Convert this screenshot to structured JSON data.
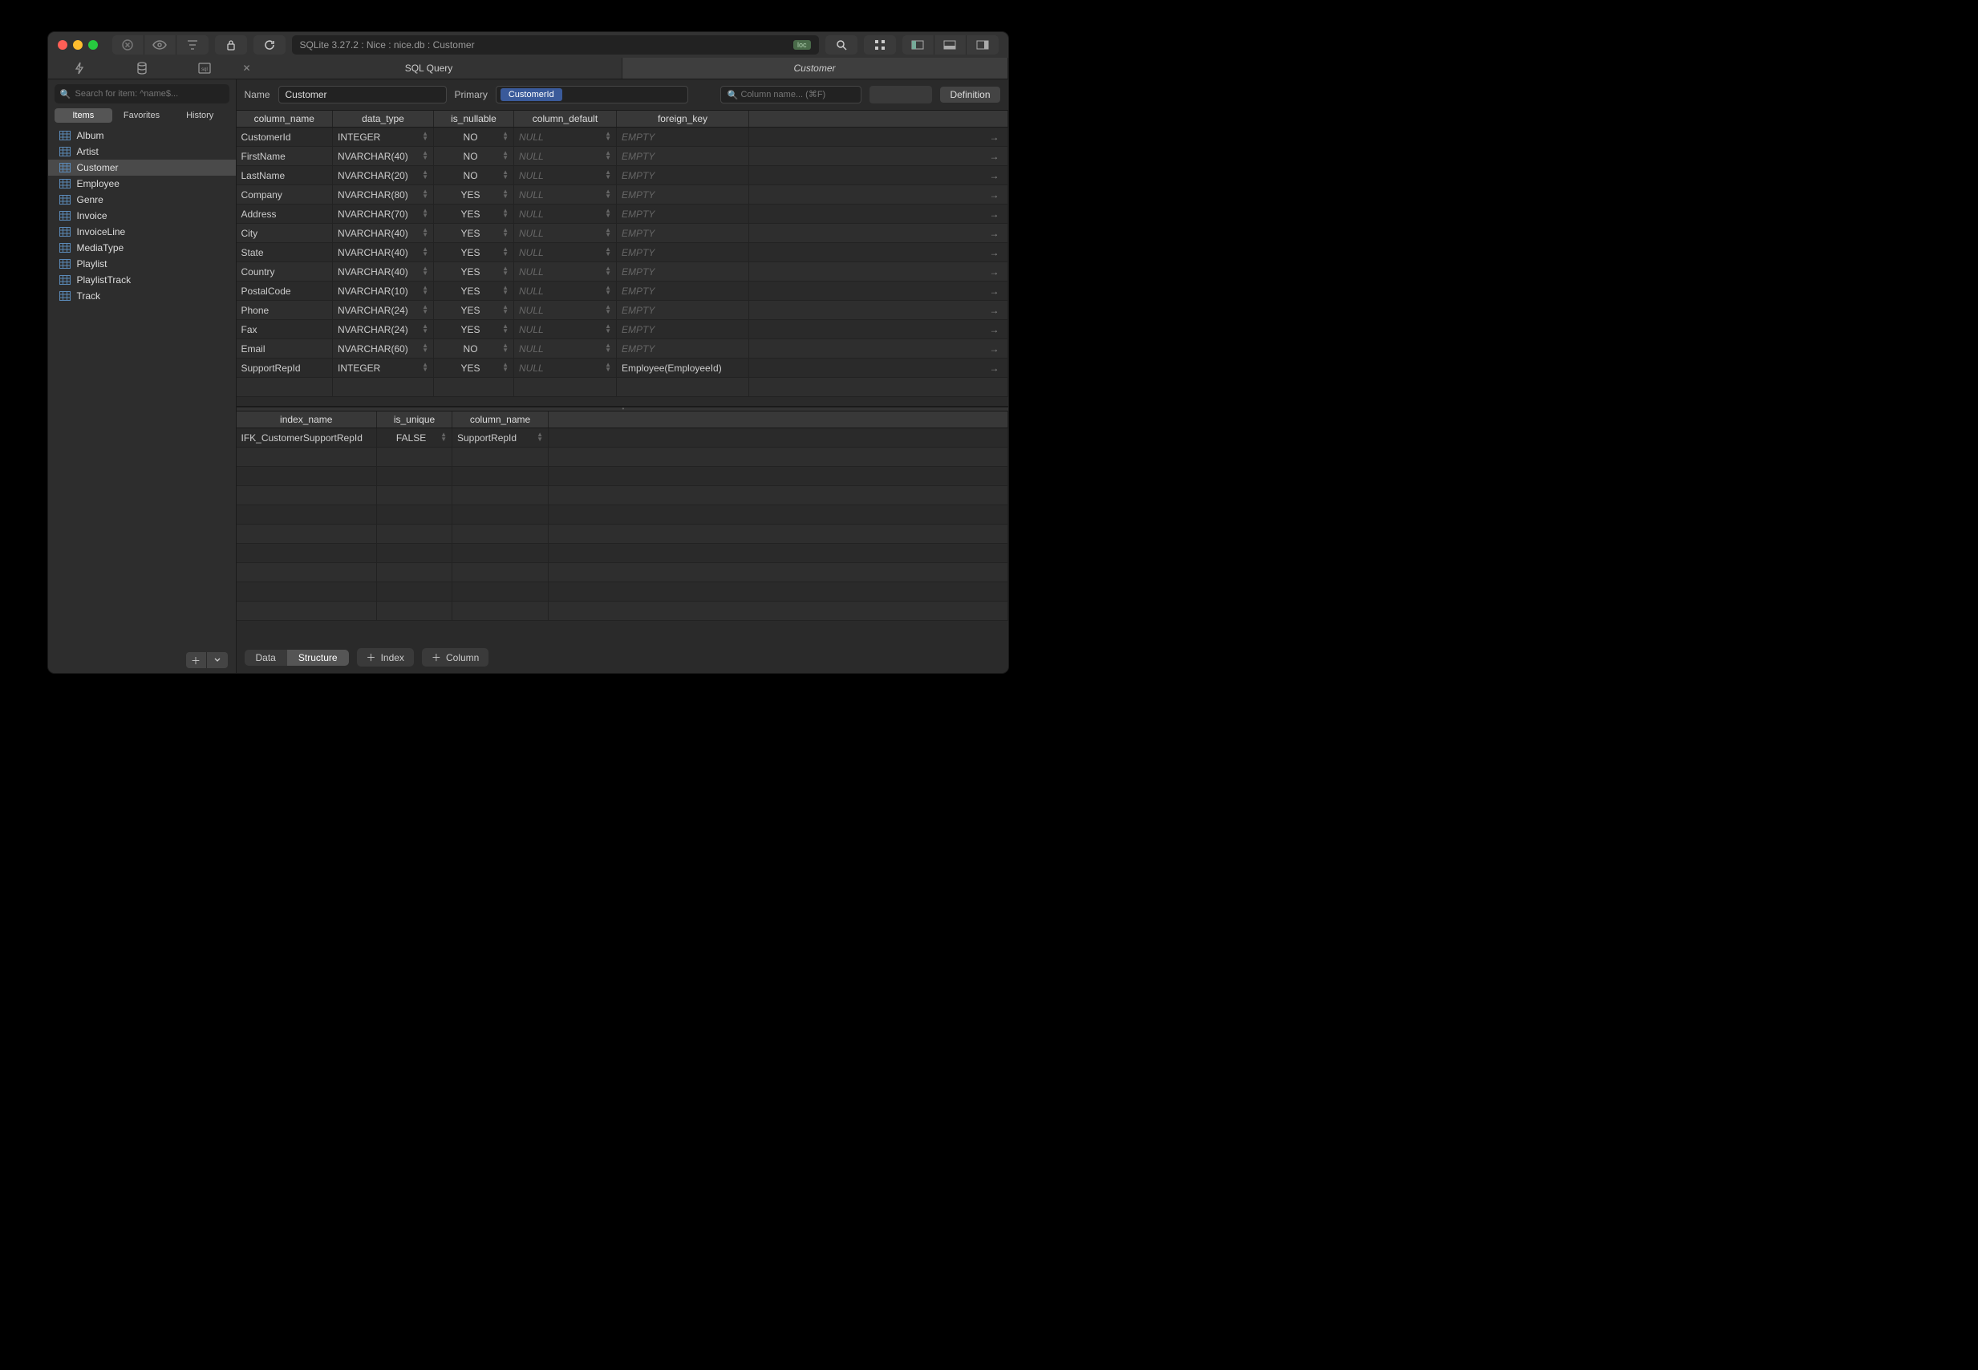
{
  "breadcrumb": "SQLite 3.27.2 : Nice : nice.db : Customer",
  "loc_badge": "loc",
  "main_tabs": [
    {
      "label": "SQL Query",
      "active": false,
      "closeable": true
    },
    {
      "label": "Customer",
      "active": true,
      "closeable": false
    }
  ],
  "search_placeholder": "Search for item: ^name$...",
  "seg_tabs": [
    "Items",
    "Favorites",
    "History"
  ],
  "seg_active": 0,
  "tables": [
    "Album",
    "Artist",
    "Customer",
    "Employee",
    "Genre",
    "Invoice",
    "InvoiceLine",
    "MediaType",
    "Playlist",
    "PlaylistTrack",
    "Track"
  ],
  "selected_table": "Customer",
  "name_label": "Name",
  "name_value": "Customer",
  "primary_label": "Primary",
  "primary_key": "CustomerId",
  "col_search_placeholder": "Column name... (⌘F)",
  "definition_label": "Definition",
  "col_headers": [
    "column_name",
    "data_type",
    "is_nullable",
    "column_default",
    "foreign_key"
  ],
  "columns": [
    {
      "name": "CustomerId",
      "type": "INTEGER",
      "nullable": "NO",
      "default": "NULL",
      "fk": "EMPTY"
    },
    {
      "name": "FirstName",
      "type": "NVARCHAR(40)",
      "nullable": "NO",
      "default": "NULL",
      "fk": "EMPTY"
    },
    {
      "name": "LastName",
      "type": "NVARCHAR(20)",
      "nullable": "NO",
      "default": "NULL",
      "fk": "EMPTY"
    },
    {
      "name": "Company",
      "type": "NVARCHAR(80)",
      "nullable": "YES",
      "default": "NULL",
      "fk": "EMPTY"
    },
    {
      "name": "Address",
      "type": "NVARCHAR(70)",
      "nullable": "YES",
      "default": "NULL",
      "fk": "EMPTY"
    },
    {
      "name": "City",
      "type": "NVARCHAR(40)",
      "nullable": "YES",
      "default": "NULL",
      "fk": "EMPTY"
    },
    {
      "name": "State",
      "type": "NVARCHAR(40)",
      "nullable": "YES",
      "default": "NULL",
      "fk": "EMPTY"
    },
    {
      "name": "Country",
      "type": "NVARCHAR(40)",
      "nullable": "YES",
      "default": "NULL",
      "fk": "EMPTY"
    },
    {
      "name": "PostalCode",
      "type": "NVARCHAR(10)",
      "nullable": "YES",
      "default": "NULL",
      "fk": "EMPTY"
    },
    {
      "name": "Phone",
      "type": "NVARCHAR(24)",
      "nullable": "YES",
      "default": "NULL",
      "fk": "EMPTY"
    },
    {
      "name": "Fax",
      "type": "NVARCHAR(24)",
      "nullable": "YES",
      "default": "NULL",
      "fk": "EMPTY"
    },
    {
      "name": "Email",
      "type": "NVARCHAR(60)",
      "nullable": "NO",
      "default": "NULL",
      "fk": "EMPTY"
    },
    {
      "name": "SupportRepId",
      "type": "INTEGER",
      "nullable": "YES",
      "default": "NULL",
      "fk": "Employee(EmployeeId)"
    }
  ],
  "idx_headers": [
    "index_name",
    "is_unique",
    "column_name"
  ],
  "indexes": [
    {
      "name": "IFK_CustomerSupportRepId",
      "unique": "FALSE",
      "col": "SupportRepId"
    }
  ],
  "footer": {
    "data": "Data",
    "structure": "Structure",
    "index": "Index",
    "column": "Column"
  }
}
